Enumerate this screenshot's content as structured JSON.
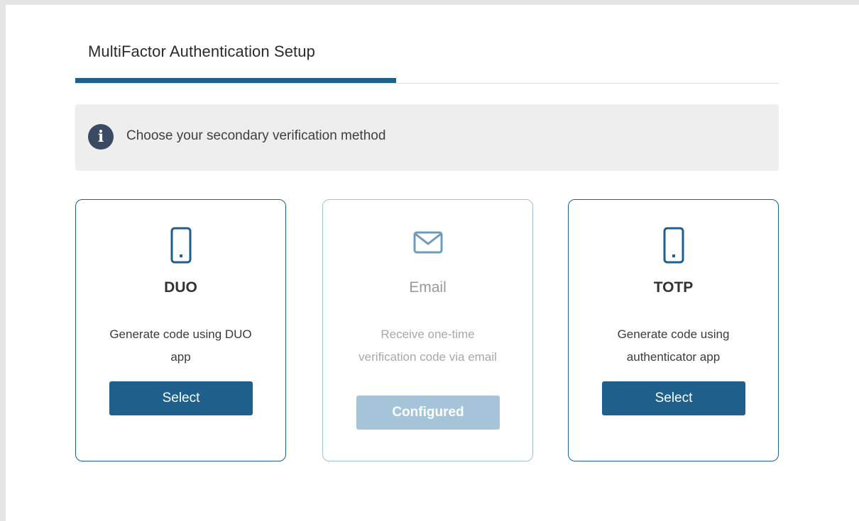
{
  "page": {
    "tab_title": "MultiFactor Authentication Setup"
  },
  "info": {
    "icon": "info-icon",
    "message": "Choose your secondary verification method"
  },
  "colors": {
    "accent": "#1e5f8c",
    "disabled_button": "#a6c4d9",
    "banner_bg": "#eeeeee"
  },
  "methods": [
    {
      "icon": "smartphone-icon",
      "title": "DUO",
      "description": "Generate code using DUO app",
      "button_label": "Select",
      "state": "available"
    },
    {
      "icon": "mail-icon",
      "title": "Email",
      "description": "Receive one-time verification code via email",
      "button_label": "Configured",
      "state": "configured"
    },
    {
      "icon": "smartphone-icon",
      "title": "TOTP",
      "description": "Generate code using authenticator app",
      "button_label": "Select",
      "state": "available"
    }
  ]
}
